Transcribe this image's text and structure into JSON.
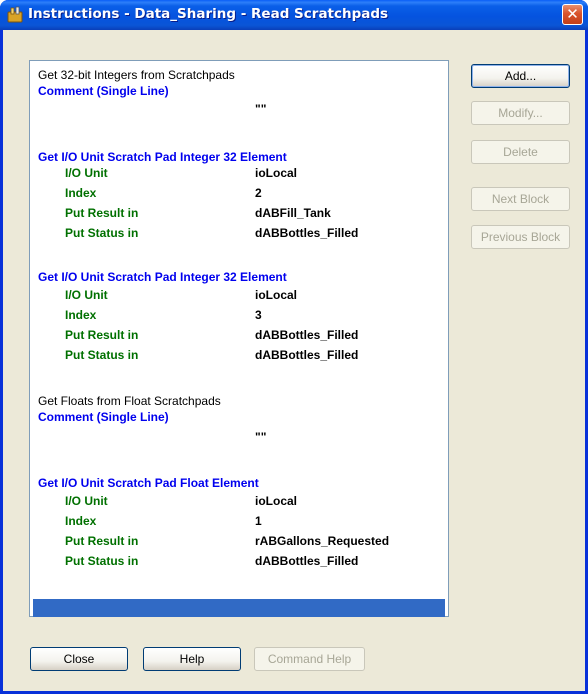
{
  "window": {
    "title": "Instructions - Data_Sharing - Read Scratchpads",
    "close_glyph": "✕"
  },
  "instructions": {
    "block1": {
      "heading": "Get 32-bit Integers from Scratchpads",
      "comment_label": "Comment (Single Line)",
      "comment_value": "\"\""
    },
    "block2": {
      "heading": "Get I/O Unit Scratch Pad Integer 32 Element",
      "params": [
        {
          "label": "I/O Unit",
          "value": "ioLocal"
        },
        {
          "label": "Index",
          "value": "2"
        },
        {
          "label": "Put Result in",
          "value": "dABFill_Tank"
        },
        {
          "label": "Put Status in",
          "value": "dABBottles_Filled"
        }
      ]
    },
    "block3": {
      "heading": "Get I/O Unit Scratch Pad Integer 32 Element",
      "params": [
        {
          "label": "I/O Unit",
          "value": "ioLocal"
        },
        {
          "label": "Index",
          "value": "3"
        },
        {
          "label": "Put Result in",
          "value": "dABBottles_Filled"
        },
        {
          "label": "Put Status in",
          "value": "dABBottles_Filled"
        }
      ]
    },
    "block4": {
      "heading": "Get Floats from Float Scratchpads",
      "comment_label": "Comment (Single Line)",
      "comment_value": "\"\""
    },
    "block5": {
      "heading": "Get I/O Unit Scratch Pad Float Element",
      "params": [
        {
          "label": "I/O Unit",
          "value": "ioLocal"
        },
        {
          "label": "Index",
          "value": "1"
        },
        {
          "label": "Put Result in",
          "value": "rABGallons_Requested"
        },
        {
          "label": "Put Status in",
          "value": "dABBottles_Filled"
        }
      ]
    }
  },
  "side_buttons": {
    "add": "Add...",
    "modify": "Modify...",
    "delete": "Delete",
    "next_block": "Next Block",
    "previous_block": "Previous Block"
  },
  "bottom_buttons": {
    "close": "Close",
    "help": "Help",
    "command_help": "Command Help"
  },
  "colors": {
    "comment_label": "#0000ee",
    "parameter_label": "#007000",
    "selection": "#316ac5"
  }
}
